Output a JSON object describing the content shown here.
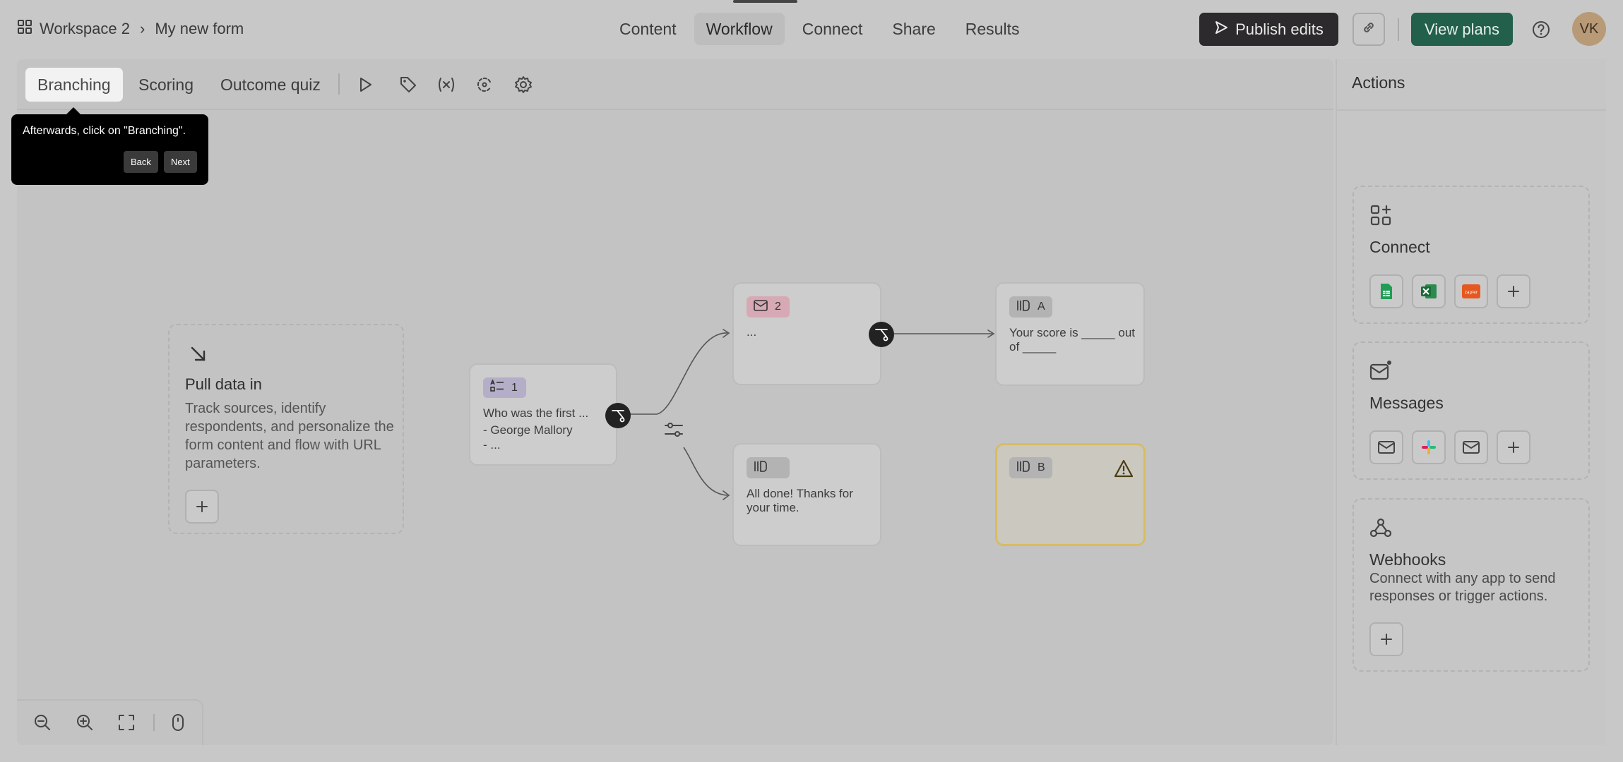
{
  "breadcrumb": {
    "workspace": "Workspace 2",
    "separator": "›",
    "form": "My new form"
  },
  "nav": {
    "tabs": [
      "Content",
      "Workflow",
      "Connect",
      "Share",
      "Results"
    ],
    "active": "Workflow"
  },
  "header": {
    "publish_label": "Publish edits",
    "plans_label": "View plans",
    "avatar_initials": "VK"
  },
  "subtabs": {
    "items": [
      "Branching",
      "Scoring",
      "Outcome quiz"
    ],
    "active": "Branching"
  },
  "tooltip": {
    "text": "Afterwards, click on \"Branching\".",
    "back_label": "Back",
    "next_label": "Next"
  },
  "pull_data": {
    "title": "Pull data in",
    "description": "Track sources, identify respondents, and personalize the form content and flow with URL parameters."
  },
  "nodes": {
    "question": {
      "badge": "1",
      "line1": "Who was the first ...",
      "line2": "- George Mallory",
      "line3": "- ..."
    },
    "email": {
      "badge": "2",
      "text": "..."
    },
    "ending_a": {
      "badge": "A",
      "line1": "Your score is _____ out",
      "line2": "of _____"
    },
    "ending_default": {
      "line1": "All done! Thanks for",
      "line2": "your time."
    },
    "ending_b": {
      "badge": "B"
    }
  },
  "actions_panel": {
    "title": "Actions",
    "connect": {
      "title": "Connect",
      "apps": [
        "google-sheets-icon",
        "excel-icon",
        "zapier-icon"
      ],
      "zapier_text": "zapier"
    },
    "messages": {
      "title": "Messages",
      "apps": [
        "email-icon",
        "slack-icon",
        "email-alt-icon"
      ]
    },
    "webhooks": {
      "title": "Webhooks",
      "description": "Connect with any app to send responses or trigger actions."
    }
  },
  "colors": {
    "publish_bg": "#2c2a2c",
    "plans_bg": "#22604c",
    "question_badge": "#b4aec8",
    "email_badge": "#d6a9b4",
    "ending_badge": "#b3b3b3",
    "warning_border": "#d8bc62"
  }
}
